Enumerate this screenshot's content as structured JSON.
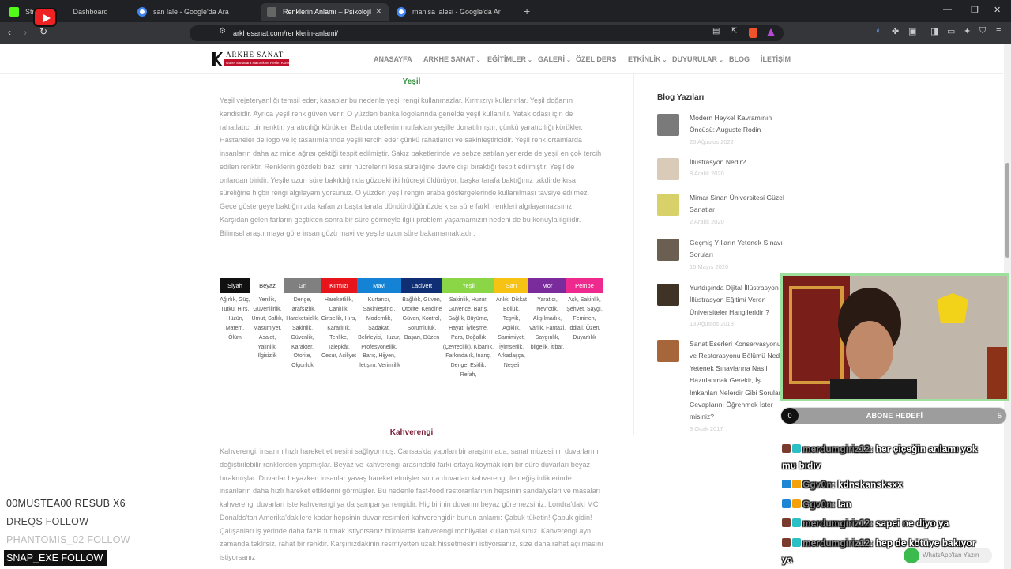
{
  "browser": {
    "tabs": [
      {
        "label": "Stre",
        "sub": "Dashboard",
        "active": false
      },
      {
        "label": "san lale - Google'da Ara",
        "active": false
      },
      {
        "label": "Renklerin Anlamı – Psikolojik ve",
        "active": true
      },
      {
        "label": "manisa lalesi - Google'da Ara",
        "active": false
      }
    ],
    "new_tab": "+",
    "url": "arkhesanat.com/renklerin-anlami/"
  },
  "site": {
    "logo_name": "ARKHE SANAT",
    "logo_sub": "Güzel Sanatlara Hazırlık ve Resim Kursu",
    "menu": [
      {
        "label": "ANASAYFA",
        "caret": false
      },
      {
        "label": "ARKHE SANAT",
        "caret": true
      },
      {
        "label": "EĞİTİMLER",
        "caret": true
      },
      {
        "label": "GALERİ",
        "caret": true
      },
      {
        "label": "ÖZEL DERS",
        "caret": false
      },
      {
        "label": "ETKİNLİK",
        "caret": true
      },
      {
        "label": "DUYURULAR",
        "caret": true
      },
      {
        "label": "BLOG",
        "caret": false
      },
      {
        "label": "İLETİŞİM",
        "caret": false
      }
    ]
  },
  "article": {
    "green_title": "Yeşil",
    "green_text": "Yeşil vejeteryanlığı temsil eder, kasaplar bu nedenle yeşil rengi kullanmazlar. Kırmızıyı kullanırlar. Yeşil doğanın kendisidir. Ayrıca yeşil renk güven verir. O yüzden banka logolarında genelde yeşil kullanılır. Yatak odası için de rahatlatıcı bir renktir, yaratıcılığı körükler. Batıda otellerin mutfakları yeşille donatılmıştır, çünkü yaratıcılığı körükler. Hastaneler de logo ve iç tasarımlarında yeşili tercih eder çünkü rahatlatıcı ve sakinleştiricidir. Yeşil renk ortamlarda insanların daha az mide ağrısı çektiği tespit edilmiştir. Sakız paketlerinde ve sebze satılan yerlerde de yeşil en çok tercih edilen renktir. Renklerin gözdeki bazı sinir hücrelerini kısa süreliğine devre dışı bıraktığı tespit edilmiştir. Yeşil de onlardan biridir. Yeşile uzun süre bakıldığında gözdeki iki hücreyi öldürüyor, başka tarafa baktığınız takdirde kısa süreliğine hiçbir rengi algılayamıyorsunuz. O yüzden yeşil rengin araba göstergelerinde kullanılması tavsiye edilmez. Gece göstergeye baktığınızda kafanızı başta tarafa döndürdüğünüzde kısa süre farklı renkleri algılayamazsınız. Karşıdan gelen farların geçtikten sonra bir süre görmeyle ilgili problem yaşamamızın nedeni de bu konuyla ilgilidir. Bilimsel araştırmaya göre insan gözü mavi ve yeşile uzun süre bakamamaktadır.",
    "brown_title": "Kahverengi",
    "brown_text": "Kahverengi, insanın hızlı hareket etmesini sağlıyormuş. Cansas'da yapılan bir araştırmada, sanat müzesinin duvarlarını değiştirilebilir renklerden yapmışlar. Beyaz ve kahverengi arasındaki farkı ortaya koymak için bir süre duvarları beyaz bırakmışlar. Duvarlar beyazken insanlar yavaş hareket etmişler sonra duvarları kahverengi ile değiştirdiklerinde insanların daha hızlı hareket ettiklerini görmüşler. Bu nedenle fast-food restoranlarının hepsinin sandalyeleri ve masaları kahverengi duvarları iste kahverengi ya da şampanya rengidir. Hiç birinin duvarını beyaz göremezsiniz. Londra'daki MC Donalds'tan Amerika'dakilere kadar hepsinin duvar resimleri kahverengidir bunun anlamı: Çabuk tüketin! Çabuk gidin! Çalışanları iş yerinde daha fazla tutmak istiyorsanız bürolarda kahverengi mobilyalar kullanmalısınız. Kahverengi aynı zamanda teklifsiz, rahat bir renktir. Karşınızdakinin resmiyetten uzak hissetmesini istiyorsanız, size daha rahat açılmasını istiyorsanız"
  },
  "color_table": [
    {
      "name": "Siyah",
      "bg": "#111111",
      "fg": "#ffffff",
      "words": "Ağırlık, Güç, Tutku, Hırs, Hüzün, Matem, Ölüm"
    },
    {
      "name": "Beyaz",
      "bg": "#ffffff",
      "fg": "#333333",
      "words": "Yenilik, Güvenilirlik, Umut, Saflık, Masumiyet, Asalet, Yalınlık, İlgisizlik"
    },
    {
      "name": "Gri",
      "bg": "#808080",
      "fg": "#ffffff",
      "words": "Denge, Tarafsızlık, Hareketsizlik, Sakinlik, Güvenlik, Karakter, Otorite, Olgunluk"
    },
    {
      "name": "Kırmızı",
      "bg": "#e8141c",
      "fg": "#ffffff",
      "words": "Hareketlilik, Canlılık, Cinsellik, Hırs, Kararlılık, Tehlike, Talepkâr, Cesur, Aciliyet"
    },
    {
      "name": "Mavi",
      "bg": "#1483d6",
      "fg": "#ffffff",
      "words": "Kurtarıcı, Sakinleştirici, Modernlik, Sadakat, Belirleyici, Huzur, Profesyonellik, Barış, Hijyen, İletişim, Verimlilik"
    },
    {
      "name": "Lacivert",
      "bg": "#0f2e74",
      "fg": "#ffffff",
      "words": "Bağlılık, Güven, Otorite, Kendine Güven, Kontrol, Sorumluluk, Başarı, Düzen"
    },
    {
      "name": "Yeşil",
      "bg": "#8ad647",
      "fg": "#ffffff",
      "words": "Sakinlik, Huzur, Güvence, Barış, Sağlık, Büyüme, Hayat, İyileşme, Para, Doğallık (Çevrecilik), Kibarlık, Farkındalık, İnanç, Denge, Eşitlik, Refah,"
    },
    {
      "name": "Sarı",
      "bg": "#f6c315",
      "fg": "#ffffff",
      "words": "Anlık, Dikkat Bolluk, Teşvik, Açıklık, Samimiyet, İyimserlik, Arkadaşça, Neşeli"
    },
    {
      "name": "Mor",
      "bg": "#7a2b9c",
      "fg": "#ffffff",
      "words": "Yaratıcı, Nevrotik, Alışılmadık, Varlık, Fantazi, Saygınlık, bilgelik, İtibar,"
    },
    {
      "name": "Pembe",
      "bg": "#ee2a8e",
      "fg": "#ffffff",
      "words": "Aşk, Sakinlik, Şehvet, Saygı, Feminen, İddiali, Özen, Duyarlılık"
    }
  ],
  "sidebar": {
    "title": "Blog Yazıları",
    "posts": [
      {
        "title": "Modern Heykel Kavramının Öncüsü: Auguste Rodin",
        "date": "26 Ağustos 2022",
        "thumb": "#7a7a7a"
      },
      {
        "title": "İllüstrasyon Nedir?",
        "date": "8 Aralık 2020",
        "thumb": "#d9cbb8"
      },
      {
        "title": "Mimar Sinan Üniversitesi Güzel Sanatlar",
        "date": "2 Aralık 2020",
        "thumb": "#d8d16a"
      },
      {
        "title": "Geçmiş Yılların Yetenek Sınavı Soruları",
        "date": "16 Mayıs 2020",
        "thumb": "#6a5f50"
      },
      {
        "title": "Yurtdışında Dijital İllüstrasyon ve İllüstrasyon Eğitimi Veren Üniversiteler Hangileridir ?",
        "date": "13 Ağustos 2018",
        "thumb": "#3e3325"
      },
      {
        "title": "Sanat Eserleri Konservasyonu ve Restorasyonu Bölümü Neden Yetenek Sınavlarına Nasıl Hazırlanmak Gerekir, İş İmkanları Nelerdir Gibi Soruların Cevaplarını Öğrenmek İster misiniz?",
        "date": "3 Ocak 2017",
        "thumb": "#a7653a"
      }
    ]
  },
  "stream": {
    "goal_count": "0",
    "goal_label": "ABONE HEDEFİ",
    "goal_target": "5",
    "chat": [
      {
        "user": "merdumgiriz12",
        "text": ": her çiçeğin anlamı yok mu bıdıv",
        "badge1": "#7a3b2e",
        "badge2": "#2bbfc6"
      },
      {
        "user": "Ggv0n",
        "text": ": kdnskansksxx",
        "badge1": "#1d87d6",
        "badge2": "#f5a10b"
      },
      {
        "user": "Ggv0n",
        "text": ": lan",
        "badge1": "#1d87d6",
        "badge2": "#f5a10b"
      },
      {
        "user": "merdumgiriz12",
        "text": ": sapei ne diyo ya",
        "badge1": "#7a3b2e",
        "badge2": "#2bbfc6"
      },
      {
        "user": "merdumgiriz12",
        "text": ": hep de kötüye bakıyor ya",
        "badge1": "#7a3b2e",
        "badge2": "#2bbfc6"
      }
    ],
    "events": [
      {
        "text": "00MUSTEA00  RESUB X6"
      },
      {
        "text": "DREQS  FOLLOW"
      },
      {
        "text": "PHANTOMIS_02  FOLLOW"
      }
    ],
    "snap": "SNAP_EXE  FOLLOW",
    "whatsapp": "WhatsApp'tan Yazın"
  }
}
